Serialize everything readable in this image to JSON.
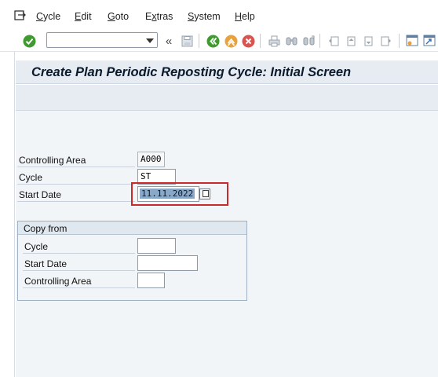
{
  "menu": {
    "items": [
      {
        "label": "Cycle"
      },
      {
        "label": "Edit"
      },
      {
        "label": "Goto"
      },
      {
        "label": "Extras"
      },
      {
        "label": "System"
      },
      {
        "label": "Help"
      }
    ]
  },
  "toolbar": {
    "command_value": "",
    "back_glyph": "«"
  },
  "title": "Create Plan Periodic Reposting Cycle: Initial Screen",
  "form": {
    "controlling_area_label": "Controlling Area",
    "controlling_area_value": "A000",
    "cycle_label": "Cycle",
    "cycle_value": "ST",
    "start_date_label": "Start Date",
    "start_date_value": "11.11.2022"
  },
  "copy_from": {
    "title": "Copy from",
    "cycle_label": "Cycle",
    "cycle_value": "",
    "start_date_label": "Start Date",
    "start_date_value": "",
    "controlling_area_label": "Controlling Area",
    "controlling_area_value": ""
  },
  "colors": {
    "highlight_border": "#c82b2b",
    "title_background": "#e6ecf2",
    "enter_green": "#3f9b2f",
    "exit_orange": "#e9a23b",
    "cancel_red": "#d9534f"
  }
}
